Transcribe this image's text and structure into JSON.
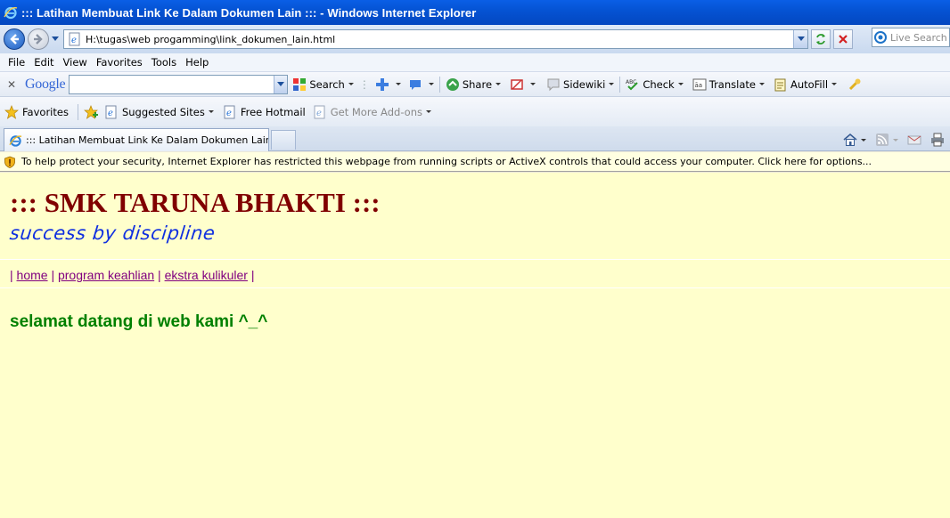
{
  "window": {
    "title": "::: Latihan Membuat Link Ke Dalam Dokumen Lain ::: - Windows Internet Explorer"
  },
  "address": {
    "url": "H:\\tugas\\web progamming\\link_dokumen_lain.html",
    "live_search_placeholder": "Live Search"
  },
  "menu": {
    "items": [
      "File",
      "Edit",
      "View",
      "Favorites",
      "Tools",
      "Help"
    ]
  },
  "google_toolbar": {
    "logo": "Google",
    "search_label": "Search",
    "share_label": "Share",
    "sidewiki_label": "Sidewiki",
    "check_label": "Check",
    "translate_label": "Translate",
    "autofill_label": "AutoFill"
  },
  "favorites_bar": {
    "favorites_label": "Favorites",
    "suggested_sites": "Suggested Sites",
    "free_hotmail": "Free Hotmail",
    "get_more_addons": "Get More Add-ons"
  },
  "tab": {
    "label": "::: Latihan Membuat Link Ke Dalam Dokumen Lain :::"
  },
  "infobar": {
    "message": "To help protect your security, Internet Explorer has restricted this webpage from running scripts or ActiveX controls that could access your computer. Click here for options..."
  },
  "page": {
    "title": "::: SMK TARUNA BHAKTI :::",
    "tagline": "success by discipline",
    "nav": {
      "home": "home",
      "program": "program keahlian",
      "ekstra": "ekstra kulikuler",
      "separator": "|"
    },
    "welcome": "selamat datang di web kami ^_^"
  },
  "colors": {
    "site_title": "#800000",
    "tagline": "#1030e0",
    "links": "#800080",
    "welcome": "#008000",
    "page_background": "#ffffcc",
    "titlebar": "#0553d4"
  },
  "icons": [
    "ie-logo-icon",
    "back-arrow-icon",
    "forward-arrow-icon",
    "refresh-icon",
    "stop-icon",
    "bing-icon",
    "star-icon",
    "home-icon",
    "rss-icon",
    "mail-icon",
    "print-icon",
    "shield-warning-icon"
  ]
}
